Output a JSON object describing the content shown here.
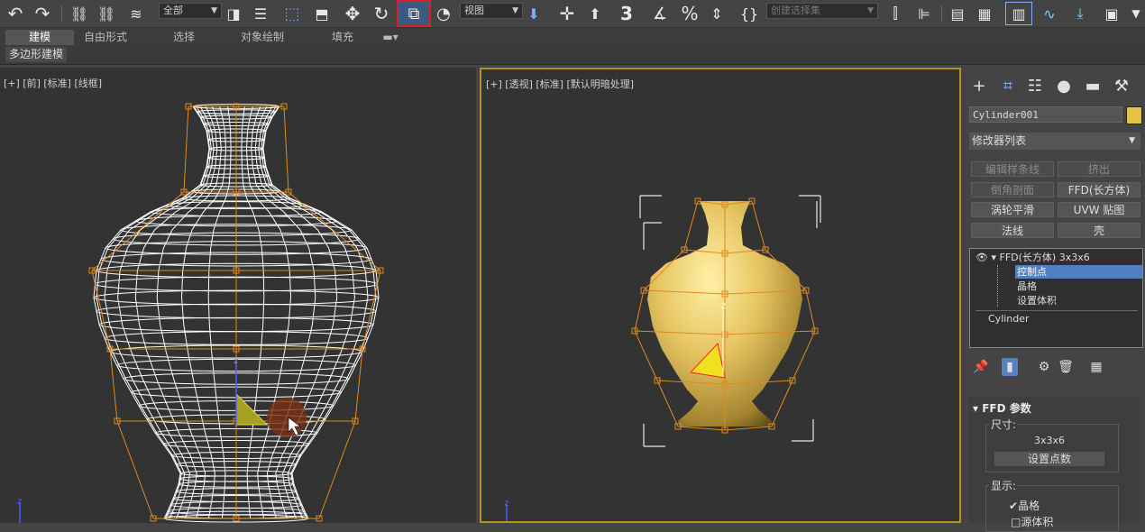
{
  "toolbar": {
    "selection_filter": "全部",
    "reference_coord": "视图",
    "named_selection_placeholder": "创建选择集",
    "icons": [
      "undo-icon",
      "redo-icon",
      "link-icon",
      "unlink-icon",
      "bind-spacewarp-icon",
      "select-object-icon",
      "select-by-name-icon",
      "rect-selection-icon",
      "window-crossing-icon",
      "move-icon",
      "rotate-icon",
      "scale-icon",
      "viewport-sync-icon",
      "snaps-icon",
      "angle-snap-icon",
      "percent-snap-icon",
      "spinner-snap-icon",
      "named-selection-icon",
      "mirror-icon",
      "align-icon",
      "layer-icon",
      "toggle-ribbon-icon",
      "curve-editor-icon",
      "render-icon",
      "render-frame-icon"
    ],
    "text_glyphs": {
      "three": "3",
      "percent": "%"
    }
  },
  "ribbon": {
    "tabs": [
      "建模",
      "自由形式",
      "选择",
      "对象绘制",
      "填充"
    ],
    "active_tab": "建模",
    "subtitle": "多边形建模"
  },
  "viewports": {
    "left": {
      "label": "[+] [前] [标准] [线框]",
      "axis": "z"
    },
    "right": {
      "label": "[+] [透视] [标准] [默认明暗处理]",
      "axis": "z"
    }
  },
  "command_panel": {
    "object_name": "Cylinder001",
    "object_color": "#e5c246",
    "modifier_list": "修改器列表",
    "buttons": [
      {
        "label": "编辑样条线",
        "enabled": false
      },
      {
        "label": "挤出",
        "enabled": false
      },
      {
        "label": "倒角剖面",
        "enabled": false
      },
      {
        "label": "FFD(长方体)",
        "enabled": true
      },
      {
        "label": "涡轮平滑",
        "enabled": true
      },
      {
        "label": "UVW 贴图",
        "enabled": true
      },
      {
        "label": "法线",
        "enabled": true
      },
      {
        "label": "壳",
        "enabled": true
      }
    ],
    "stack": {
      "modifier": "FFD(长方体) 3x3x6",
      "sub_items": [
        "控制点",
        "晶格",
        "设置体积"
      ],
      "selected_sub": "控制点",
      "base": "Cylinder"
    },
    "ffd": {
      "header": "FFD 参数",
      "dimensions_title": "尺寸:",
      "dimensions_value": "3x3x6",
      "set_points_button": "设置点数",
      "display_title": "显示:",
      "lattice_label": "晶格",
      "lattice_checked": true,
      "source_volume_label": "源体积"
    }
  }
}
